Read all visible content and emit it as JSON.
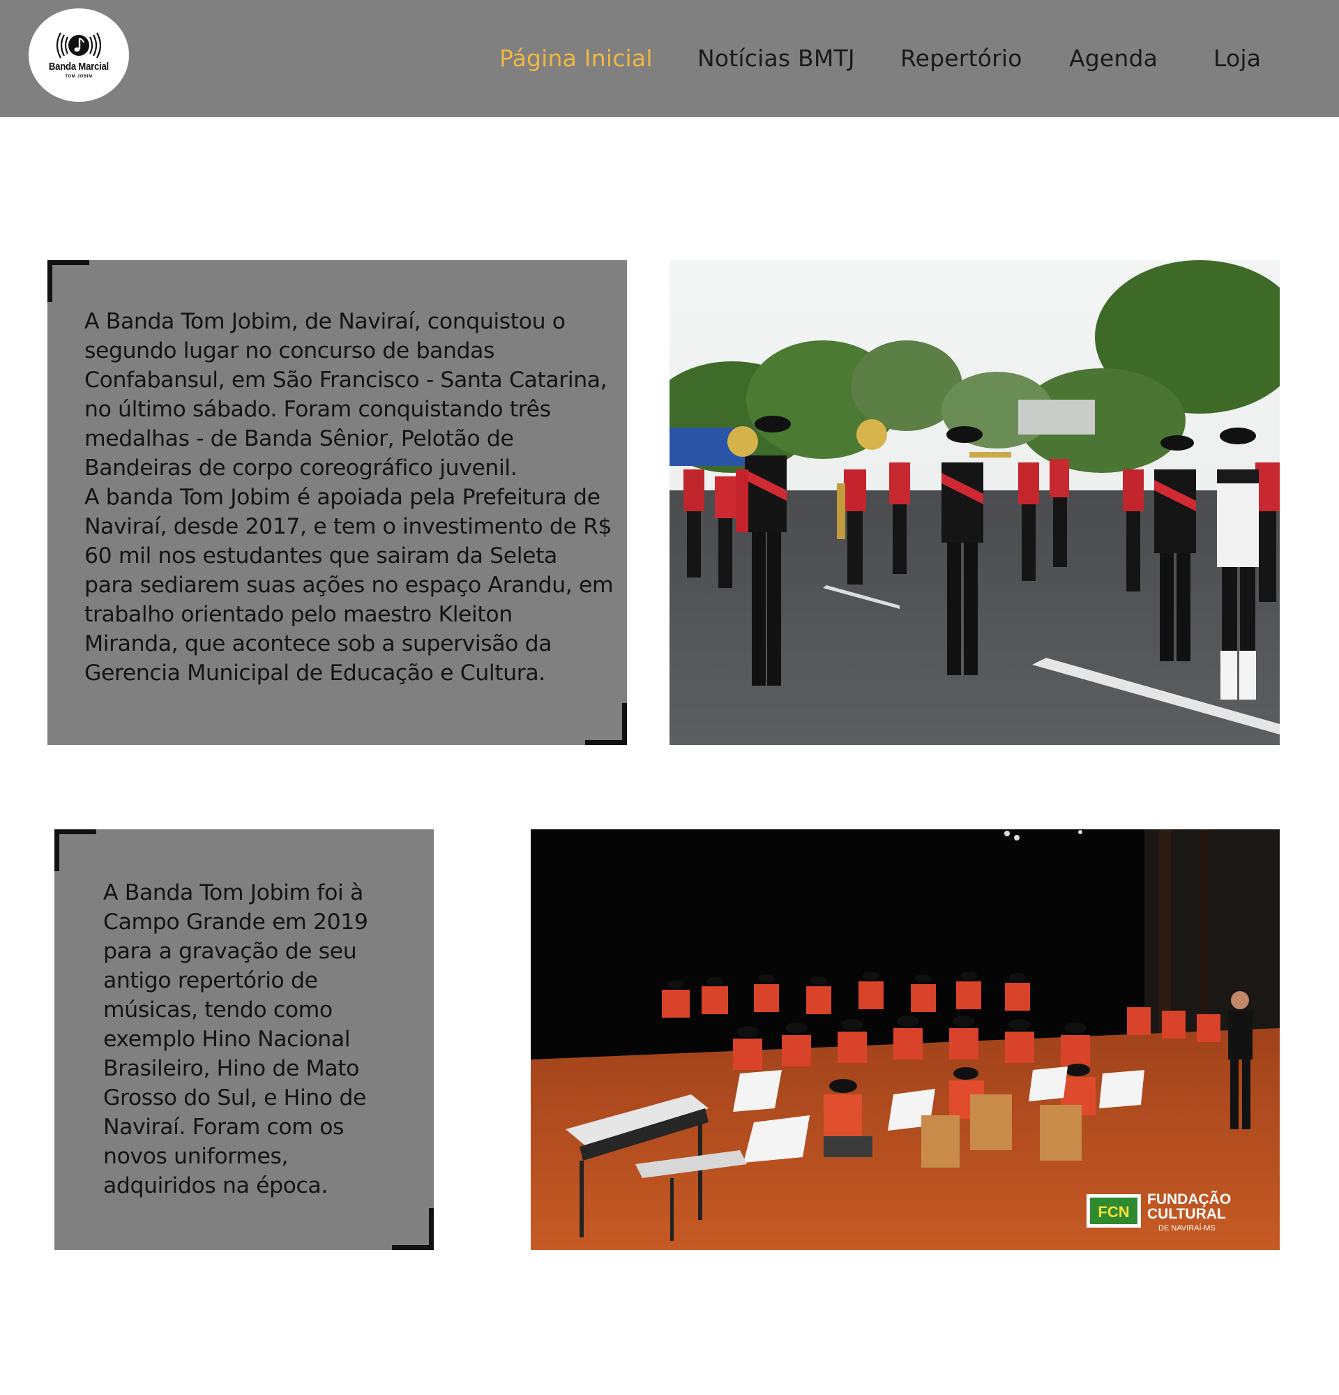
{
  "header": {
    "logo": {
      "icon": "music-note-signal-icon",
      "title": "Banda Marcial",
      "subtitle": "TOM JOBIM"
    },
    "nav": [
      {
        "label": "Página Inicial",
        "active": true
      },
      {
        "label": "Notícias BMTJ",
        "active": false
      },
      {
        "label": "Repertório",
        "active": false
      },
      {
        "label": "Agenda",
        "active": false
      },
      {
        "label": "Loja",
        "active": false
      }
    ],
    "active_color": "#f0b73f",
    "background": "#808080"
  },
  "sections": [
    {
      "text": "A Banda Tom Jobim, de Naviraí, conquistou o\nsegundo lugar no concurso de bandas\nConfabansul, em São Francisco - Santa Catarina,\nno último sábado. Foram conquistando três\nmedalhas - de Banda Sênior, Pelotão de\nBandeiras de corpo coreográfico juvenil.\nA banda Tom Jobim é apoiada pela Prefeitura de\nNaviraí, desde 2017, e tem o investimento de R$\n60 mil nos estudantes que sairam da Seleta\npara sediarem suas ações no espaço Arandu, em\ntrabalho orientado pelo maestro Kleiton\nMiranda, que acontece sob a supervisão da\nGerencia Municipal de Educação e Cultura.",
      "image": "marching-band-parade-photo"
    },
    {
      "text": "A Banda Tom Jobim foi à\nCampo Grande em 2019\npara a gravação de seu\nantigo repertório de\nmúsicas, tendo como\nexemplo Hino Nacional\nBrasileiro, Hino de Mato\nGrosso do Sul, e Hino de\nNaviraí. Foram com os\nnovos uniformes,\nadquiridos na época.",
      "image": "band-stage-concert-photo",
      "watermark": {
        "logo_text": "FCN",
        "line1": "FUNDAÇÃO",
        "line2": "CULTURAL",
        "line3": "DE NAVIRAÍ-MS"
      }
    }
  ]
}
